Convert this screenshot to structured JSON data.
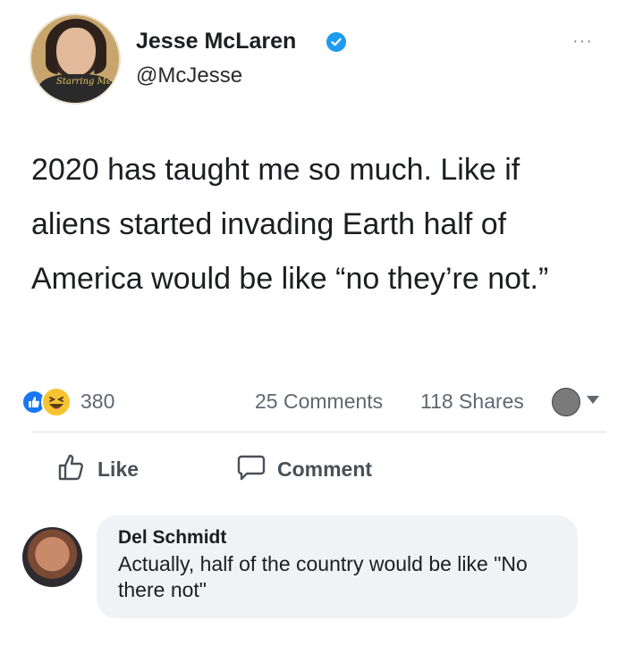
{
  "post": {
    "author_name": "Jesse McLaren",
    "author_handle": "@McJesse",
    "avatar_text": "Starring Me",
    "more_icon": "more-options-icon",
    "text": "2020 has taught me so much. Like if aliens started invading Earth half of America would be like “no they’re not.”"
  },
  "stats": {
    "reaction_count": "380",
    "comments": "25 Comments",
    "shares": "118 Shares"
  },
  "actions": {
    "like_label": "Like",
    "comment_label": "Comment"
  },
  "comment": {
    "author": "Del Schmidt",
    "text": "Actually, half of the country would be like \"No there not\""
  },
  "colors": {
    "verified": "#1d9bf0",
    "like_blue": "#1877f2",
    "haha_yellow": "#f7c431",
    "bubble_bg": "#f0f2f5"
  }
}
